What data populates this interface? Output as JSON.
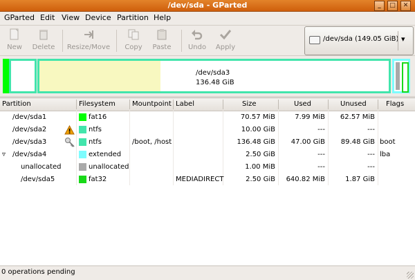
{
  "window": {
    "title": "/dev/sda - GParted"
  },
  "menu": [
    "GParted",
    "Edit",
    "View",
    "Device",
    "Partition",
    "Help"
  ],
  "toolbar": {
    "new": "New",
    "delete": "Delete",
    "resize_move": "Resize/Move",
    "copy": "Copy",
    "paste": "Paste",
    "undo": "Undo",
    "apply": "Apply",
    "device": "/dev/sda  (149.05 GiB)"
  },
  "map": {
    "selected_name": "/dev/sda3",
    "selected_size": "136.48 GiB",
    "colors": {
      "fat16": "#00ff00",
      "ntfs": "#42e5ac",
      "extended": "#7dfcfe",
      "unallocated": "#a9a9a9",
      "fat32": "#18d918",
      "used": "#f8f8c0"
    }
  },
  "table": {
    "headers": [
      "Partition",
      "Filesystem",
      "Mountpoint",
      "Label",
      "Size",
      "Used",
      "Unused",
      "Flags"
    ],
    "rows": [
      {
        "partition": "/dev/sda1",
        "fs": "fat16",
        "color": "#00ff00",
        "mount": "",
        "label": "",
        "size": "70.57 MiB",
        "used": "7.99 MiB",
        "unused": "62.57 MiB",
        "flags": "",
        "icon": ""
      },
      {
        "partition": "/dev/sda2",
        "fs": "ntfs",
        "color": "#42e5ac",
        "mount": "",
        "label": "",
        "size": "10.00 GiB",
        "used": "---",
        "unused": "---",
        "flags": "",
        "icon": "warning-icon"
      },
      {
        "partition": "/dev/sda3",
        "fs": "ntfs",
        "color": "#42e5ac",
        "mount": "/boot, /host",
        "label": "",
        "size": "136.48 GiB",
        "used": "47.00 GiB",
        "unused": "89.48 GiB",
        "flags": "boot",
        "icon": "key-icon"
      },
      {
        "partition": "/dev/sda4",
        "fs": "extended",
        "color": "#7dfcfe",
        "mount": "",
        "label": "",
        "size": "2.50 GiB",
        "used": "---",
        "unused": "---",
        "flags": "lba",
        "icon": ""
      },
      {
        "partition": "unallocated",
        "fs": "unallocated",
        "color": "#a9a9a9",
        "mount": "",
        "label": "",
        "size": "1.00 MiB",
        "used": "---",
        "unused": "---",
        "flags": "",
        "icon": ""
      },
      {
        "partition": "/dev/sda5",
        "fs": "fat32",
        "color": "#18d918",
        "mount": "",
        "label": "MEDIADIRECT",
        "size": "2.50 GiB",
        "used": "640.82 MiB",
        "unused": "1.87 GiB",
        "flags": "",
        "icon": ""
      }
    ]
  },
  "status": "0 operations pending"
}
